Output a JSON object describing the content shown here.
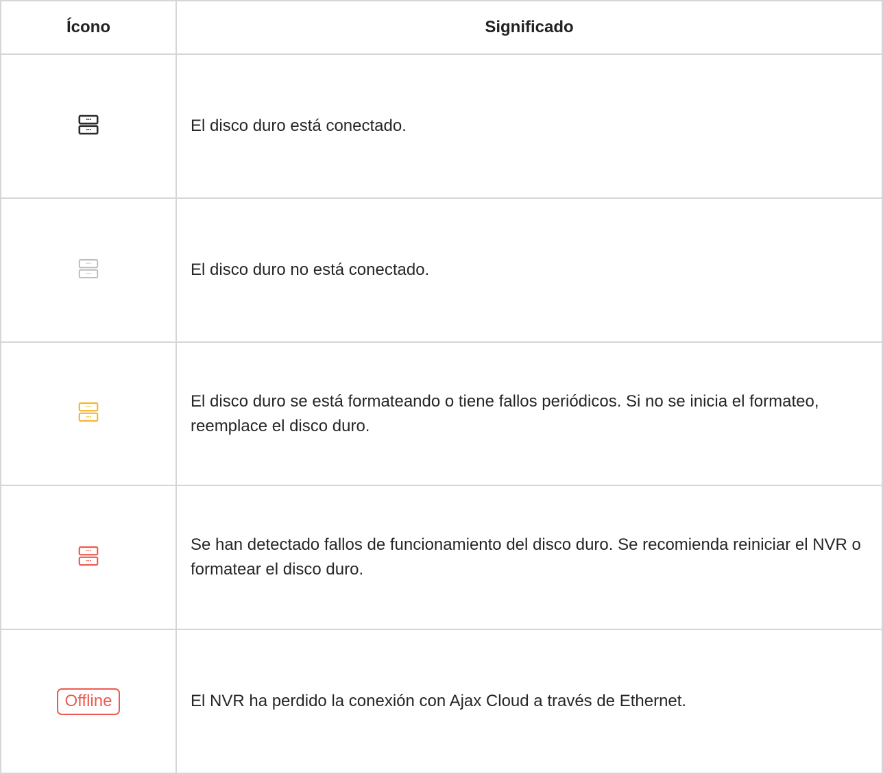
{
  "table": {
    "header": {
      "icon_col": "Ícono",
      "meaning_col": "Significado"
    },
    "rows": [
      {
        "icon": "hdd-connected-icon",
        "icon_color": "#2b2b2b",
        "text": "El disco duro está conectado."
      },
      {
        "icon": "hdd-disconnected-icon",
        "icon_color": "#bdbdbd",
        "text": "El disco duro no está conectado."
      },
      {
        "icon": "hdd-formatting-icon",
        "icon_color": "#f5b731",
        "text": "El disco duro se está formateando o tiene fallos periódicos. Si no se inicia el formateo, reemplace el disco duro."
      },
      {
        "icon": "hdd-error-icon",
        "icon_color": "#ee5a50",
        "text": "Se han detectado fallos de funcionamiento del disco duro. Se recomienda reiniciar el NVR o formatear el disco duro."
      },
      {
        "icon": "offline-badge",
        "icon_color": "#ee5a50",
        "badge_label": "Offline",
        "text": "El NVR ha perdido la conexión con Ajax Cloud a través de Ethernet."
      }
    ]
  }
}
